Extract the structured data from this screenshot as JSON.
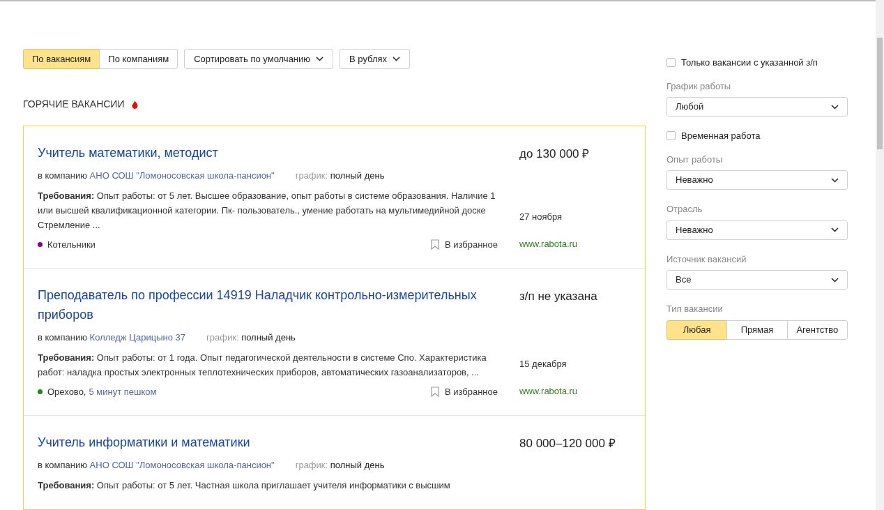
{
  "view_toggle": [
    {
      "label": "По вакансиям",
      "selected": true
    },
    {
      "label": "По компаниям",
      "selected": false
    }
  ],
  "sort": {
    "value": "Сортировать по умолчанию"
  },
  "currency": {
    "value": "В рублях"
  },
  "section_title": "ГОРЯЧИЕ ВАКАНСИИ",
  "vacancies": [
    {
      "title": "Учитель математики, методист",
      "salary": "до 130 000 ₽",
      "company_prefix": "в компанию",
      "company": "АНО СОШ \"Ломоносовская школа-пансион\"",
      "schedule_label": "график:",
      "schedule": "полный день",
      "requirements": "**Требования:** Опыт работы: от 5 лет. Высшее образование, опыт работы в системе образования. Наличие 1 или высшей квалификационной категории. Пк- пользователь., умение работать на мультимедийной доске Стремление ...",
      "date": "27 ноября",
      "location": "Котельники",
      "color": "#8b008b",
      "favorite": "В избранное",
      "source": "www.rabota.ru"
    },
    {
      "title": "Преподаватель по профессии 14919 Наладчик контрольно-измерительных приборов",
      "salary": "з/п не указана",
      "company_prefix": "в компанию",
      "company": "Колледж Царицыно 37",
      "schedule_label": "график:",
      "schedule": "полный день",
      "requirements": "**Требования:** Опыт работы: от 1 года. Опыт педагогической деятельности в системе Спо. Характеристика работ: наладка простых электронных теплотехнических приборов, автоматических газоанализаторов, ...",
      "date": "15 декабря",
      "location": "Орехово,",
      "color": "#1a8a1a",
      "distance": "5 минут пешком",
      "favorite": "В избранное",
      "source": "www.rabota.ru"
    },
    {
      "title": "Учитель информатики и математики",
      "salary": "80 000–120 000 ₽",
      "company_prefix": "в компанию",
      "company": "АНО СОШ \"Ломоносовская школа-пансион\"",
      "schedule_label": "график:",
      "schedule": "полный день",
      "requirements": "**Требования:** Опыт работы: от 5 лет. Частная школа приглашает учителя информатики с высшим"
    }
  ],
  "filters": [
    {
      "kind": "checkbox",
      "label": "Только вакансии с указанной з/п",
      "checked": false
    },
    {
      "kind": "select",
      "label": "График работы",
      "value": "Любой"
    },
    {
      "kind": "checkbox",
      "label": "Временная работа",
      "checked": false
    },
    {
      "kind": "select",
      "label": "Опыт работы",
      "value": "Неважно"
    },
    {
      "kind": "select",
      "label": "Отрасль",
      "value": "Неважно"
    },
    {
      "kind": "select",
      "label": "Источник вакансий",
      "value": "Все"
    },
    {
      "kind": "segmented",
      "label": "Тип вакансии",
      "options": [
        {
          "label": "Любая",
          "selected": true
        },
        {
          "label": "Прямая",
          "selected": false
        },
        {
          "label": "Агентство",
          "selected": false
        }
      ]
    }
  ]
}
